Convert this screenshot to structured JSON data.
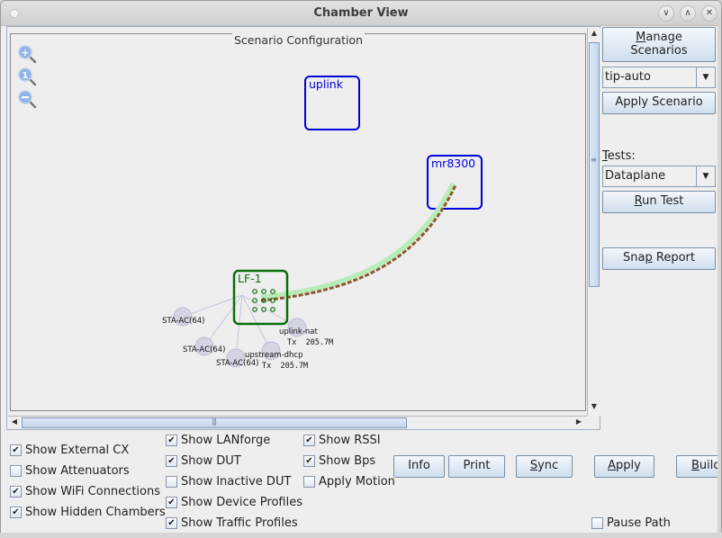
{
  "window": {
    "title": "Chamber View",
    "controls": [
      "minimize",
      "maximize",
      "close"
    ]
  },
  "scenario_panel": {
    "title": "Scenario Configuration",
    "zoom_tools": [
      {
        "name": "zoom-in",
        "glyph": "+"
      },
      {
        "name": "zoom-reset",
        "glyph": "1"
      },
      {
        "name": "zoom-out",
        "glyph": "-"
      }
    ],
    "chambers": [
      {
        "name": "uplink",
        "color": "#0000dd"
      },
      {
        "name": "mr8300",
        "color": "#0000dd"
      },
      {
        "name": "LF-1",
        "color": "#0a6e0a"
      }
    ],
    "profiles": [
      {
        "label": "STA-AC(64)",
        "tx": ""
      },
      {
        "label": "STA-AC(64)",
        "tx": ""
      },
      {
        "label": "STA-AC(64)",
        "tx": ""
      },
      {
        "label": "upstream-dhcp",
        "tx": "Tx  205.7M"
      },
      {
        "label": "uplink-nat",
        "tx": "Tx  205.7M"
      }
    ],
    "link_colors": {
      "wifi": "#b6ecb6",
      "path": "#8a5a2c"
    },
    "scroll": {
      "vertical_fraction": 0.0,
      "horizontal_fraction": 0.0
    }
  },
  "sidebar": {
    "manage_scenarios_line1": "Manage",
    "manage_scenarios_line2": "Scenarios",
    "manage_mnemonic": "M",
    "scenario_select": "tip-auto",
    "apply_scenario": "Apply Scenario",
    "tests_label": "Tests:",
    "tests_mnemonic": "T",
    "tests_select": "Dataplane",
    "run_test": "Run Test",
    "run_mnemonic": "R",
    "snap_report": "Snap Report"
  },
  "options": {
    "col1": [
      {
        "label": "Show External CX",
        "checked": true
      },
      {
        "label": "Show Attenuators",
        "checked": false
      },
      {
        "label": "Show WiFi Connections",
        "checked": true
      },
      {
        "label": "Show Hidden Chambers",
        "checked": true
      }
    ],
    "col2": [
      {
        "label": "Show LANforge",
        "checked": true
      },
      {
        "label": "Show DUT",
        "checked": true
      },
      {
        "label": "Show Inactive DUT",
        "checked": false
      },
      {
        "label": "Show Device Profiles",
        "checked": true
      },
      {
        "label": "Show Traffic Profiles",
        "checked": true
      }
    ],
    "col3": [
      {
        "label": "Show RSSI",
        "checked": true
      },
      {
        "label": "Show Bps",
        "checked": true
      },
      {
        "label": "Apply Motion",
        "checked": false
      }
    ],
    "pause_path": {
      "label": "Pause Path",
      "checked": false
    }
  },
  "actions": {
    "info": "Info",
    "print": "Print",
    "sync": "Sync",
    "apply": "Apply",
    "build": "Build"
  }
}
